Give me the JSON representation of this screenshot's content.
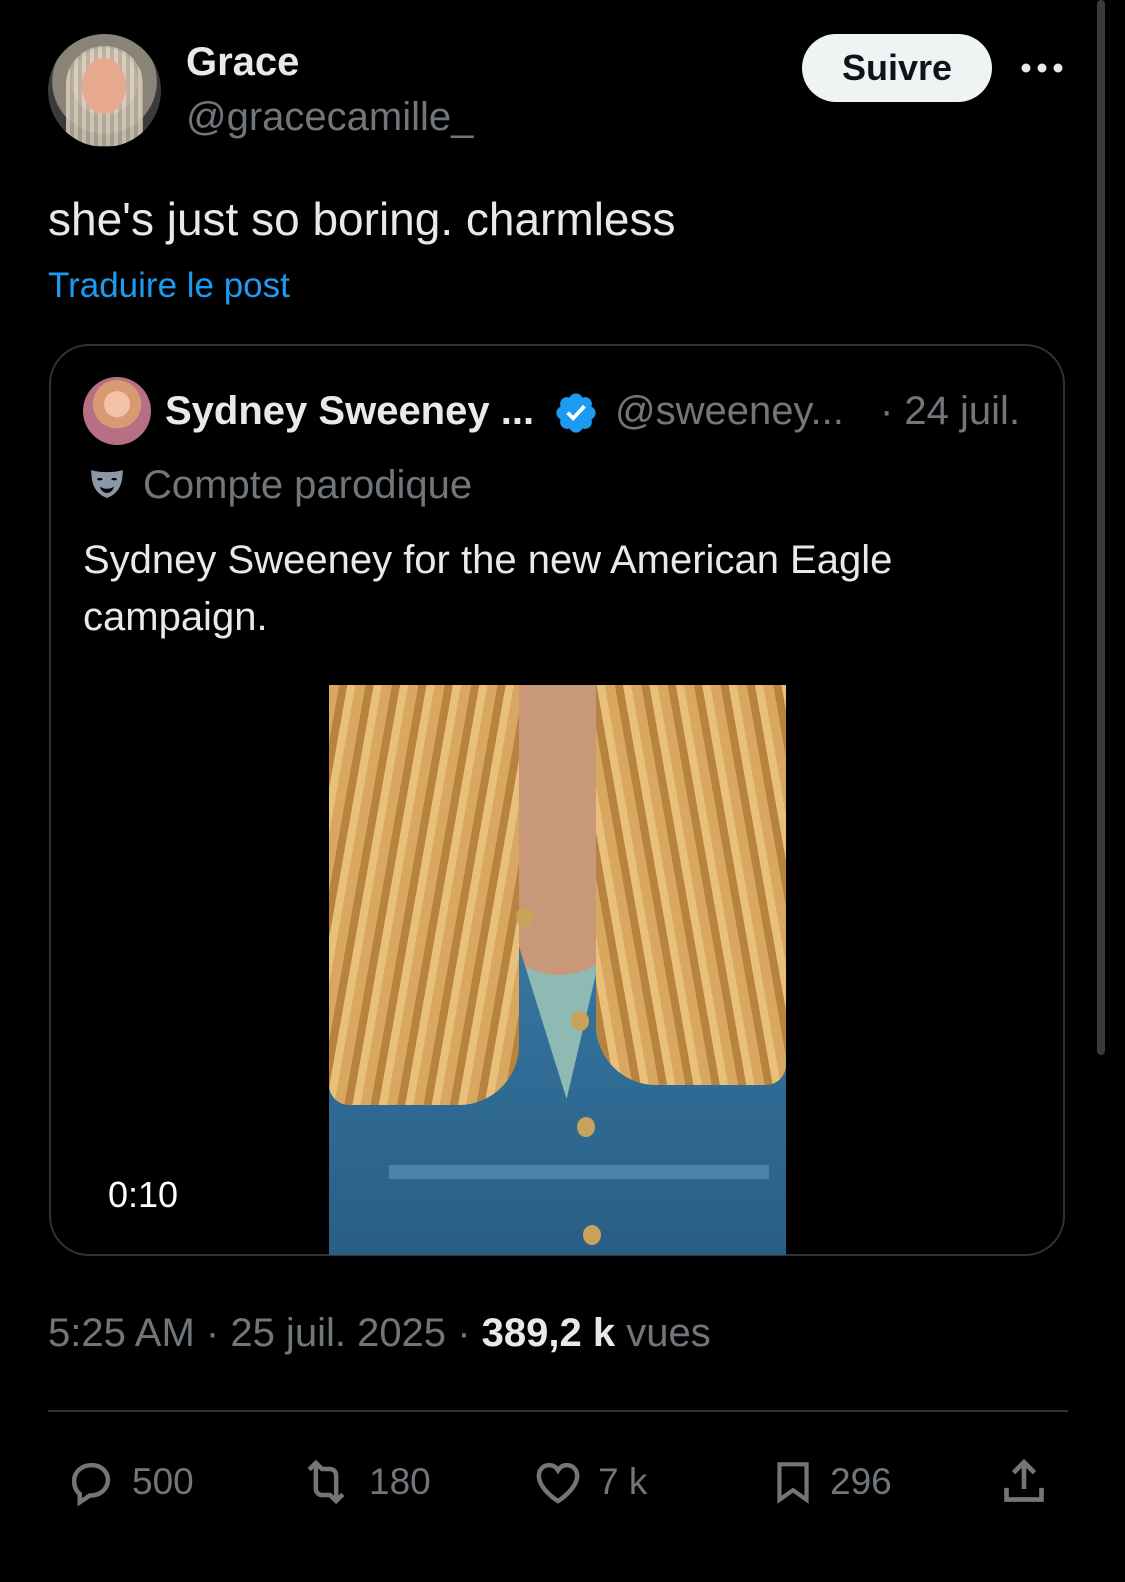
{
  "post": {
    "author_name": "Grace",
    "author_handle": "@gracecamille_",
    "follow_label": "Suivre",
    "text": "she's just so boring. charmless",
    "translate_label": "Traduire le post"
  },
  "quote": {
    "author_name": "Sydney Sweeney ...",
    "author_handle": "@sweeney...",
    "date": "· 24 juil.",
    "parody_label": "Compte parodique",
    "text": "Sydney Sweeney for the new American Eagle campaign.",
    "video_duration": "0:10"
  },
  "meta": {
    "time": "5:25 AM",
    "date": "25 juil. 2025",
    "views_count": "389,2 k",
    "views_label": "vues"
  },
  "actions": {
    "replies": "500",
    "reposts": "180",
    "likes": "7 k",
    "bookmarks": "296"
  },
  "colors": {
    "background": "#000000",
    "accent_link": "#1d9bf0",
    "muted_text": "#71767b",
    "verified": "#1d9bf0"
  },
  "icons": [
    "more-icon",
    "verified-icon",
    "parody-mask-icon",
    "reply-icon",
    "repost-icon",
    "like-icon",
    "bookmark-icon",
    "share-icon"
  ]
}
